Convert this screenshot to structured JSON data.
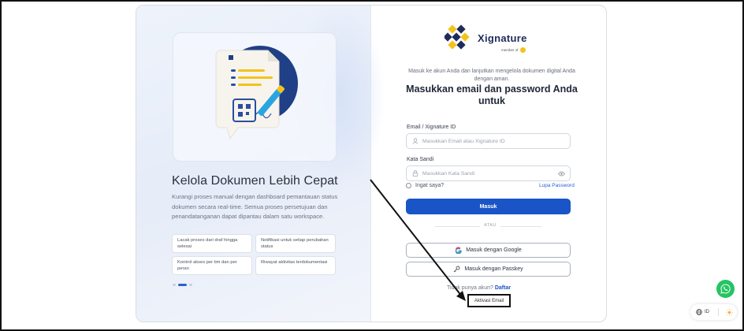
{
  "left_panel": {
    "heading": "Kelola Dokumen Lebih Cepat",
    "description": "Kurangi proses manual dengan dashboard pemantauan status dokumen secara real-time. Semua proses persetujuan dan penandatanganan dapat dipantau dalam satu workspace.",
    "features": [
      "Lacak proses dari draf hingga selesai",
      "Notifikasi untuk setiap perubahan status",
      "Kontrol akses per tim dan per peran",
      "Riwayat aktivitas terdokumentasi"
    ],
    "carousel_active_index": 1,
    "carousel_count": 3
  },
  "brand": {
    "name": "Xignature",
    "member_of": "member of"
  },
  "login": {
    "intro": "Masuk ke akun Anda dan lanjutkan mengelola dokumen digital Anda dengan aman.",
    "title": "Masukkan email dan password Anda untuk",
    "email_label": "Email / Xignature ID",
    "email_placeholder": "Masukkan Email atau Xignature ID",
    "password_label": "Kata Sandi",
    "password_placeholder": "Masukkan Kata Sandi",
    "remember_label": "Ingat saya?",
    "forgot_label": "Lupa Password",
    "submit_label": "Masuk",
    "divider_label": "ATAU",
    "google_label": "Masuk dengan Google",
    "passkey_label": "Masuk dengan Passkey",
    "signup_prompt": "Tidak punya akun?",
    "signup_link": "Daftar",
    "activate_label": "Aktivasi Email"
  },
  "widgets": {
    "language": "ID"
  },
  "colors": {
    "primary": "#1a55c7",
    "brand_navy": "#1f2b5a",
    "brand_gold": "#f4c21b",
    "whatsapp": "#25c463"
  }
}
